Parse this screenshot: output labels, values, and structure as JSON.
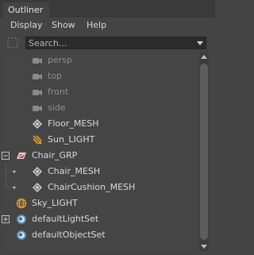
{
  "window": {
    "tab": "Outliner"
  },
  "menu": [
    "Display",
    "Show",
    "Help"
  ],
  "search": {
    "placeholder": "Search..."
  },
  "tree": [
    {
      "label": "persp",
      "icon": "camera-icon"
    },
    {
      "label": "top",
      "icon": "camera-icon"
    },
    {
      "label": "front",
      "icon": "camera-icon"
    },
    {
      "label": "side",
      "icon": "camera-icon"
    },
    {
      "label": "Floor_MESH",
      "icon": "mesh-icon"
    },
    {
      "label": "Sun_LIGHT",
      "icon": "directional-light-icon"
    },
    {
      "label": "Chair_GRP",
      "icon": "group-icon"
    },
    {
      "label": "Chair_MESH",
      "icon": "mesh-icon"
    },
    {
      "label": "ChairCushion_MESH",
      "icon": "mesh-icon"
    },
    {
      "label": "Sky_LIGHT",
      "icon": "skydome-light-icon"
    },
    {
      "label": "defaultLightSet",
      "icon": "set-icon"
    },
    {
      "label": "defaultObjectSet",
      "icon": "set-icon"
    }
  ],
  "colors": {
    "background": "#444444",
    "dim_text": "#8e8e8e",
    "text": "#d9d9d9",
    "sun_icon": "#e8a317",
    "sky_icon": "#e8a317"
  }
}
